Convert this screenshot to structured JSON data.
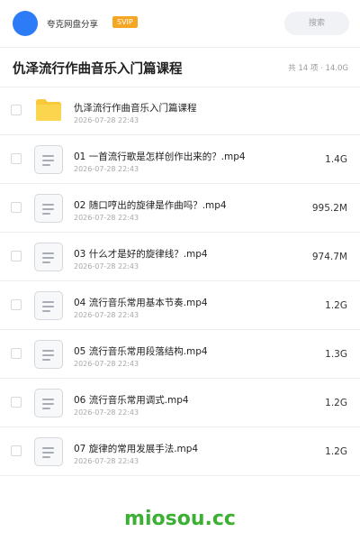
{
  "topbar": {
    "username": "夸克网盘分享",
    "vip_label": "SVIP",
    "search_label": "搜索"
  },
  "header": {
    "title": "仇泽流行作曲音乐入门篇课程",
    "summary": "共 14 项 · 14.0G"
  },
  "files": [
    {
      "name": "仇泽流行作曲音乐入门篇课程",
      "date": "2026-07-28 22:43",
      "size": "",
      "type": "folder"
    },
    {
      "name": "01 一首流行歌是怎样创作出来的？.mp4",
      "date": "2026-07-28 22:43",
      "size": "1.4G",
      "type": "file"
    },
    {
      "name": "02 随口哼出的旋律是作曲吗？.mp4",
      "date": "2026-07-28 22:43",
      "size": "995.2M",
      "type": "file"
    },
    {
      "name": "03 什么才是好的旋律线？.mp4",
      "date": "2026-07-28 22:43",
      "size": "974.7M",
      "type": "file"
    },
    {
      "name": "04 流行音乐常用基本节奏.mp4",
      "date": "2026-07-28 22:43",
      "size": "1.2G",
      "type": "file"
    },
    {
      "name": "05 流行音乐常用段落结构.mp4",
      "date": "2026-07-28 22:43",
      "size": "1.3G",
      "type": "file"
    },
    {
      "name": "06 流行音乐常用调式.mp4",
      "date": "2026-07-28 22:43",
      "size": "1.2G",
      "type": "file"
    },
    {
      "name": "07 旋律的常用发展手法.mp4",
      "date": "2026-07-28 22:43",
      "size": "1.2G",
      "type": "file"
    }
  ],
  "watermark": "miosou.cc",
  "colors": {
    "avatar": "#2b7cf6",
    "vip_badge": "#f5a623",
    "folder": "#f9c93a",
    "watermark": "#3cb035"
  }
}
